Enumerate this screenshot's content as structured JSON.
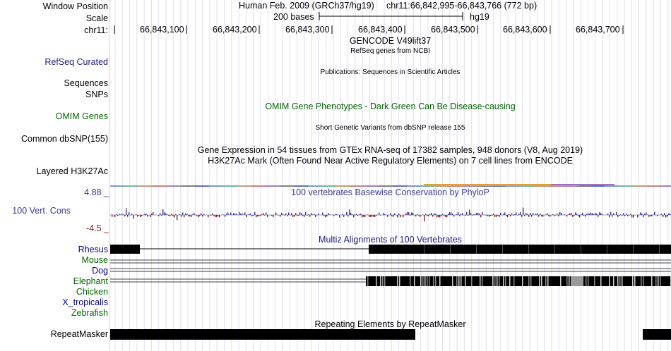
{
  "header": {
    "window_position_label": "Window Position",
    "scale_label": "Scale",
    "chrom_label": "chr11:",
    "assembly": "Human Feb. 2009 (GRCh37/hg19)",
    "position": "chr11:66,842,995-66,843,766 (772 bp)",
    "scale_text": "200 bases",
    "db": "hg19",
    "ruler_ticks": [
      "66,843,100",
      "66,843,200",
      "66,843,300",
      "66,843,400",
      "66,843,500",
      "66,843,600",
      "66,843,700"
    ]
  },
  "tracks": {
    "gencode_title": "GENCODE V49lift37",
    "refseq_sub": "RefSeq genes from NCBI",
    "refseq_label": "RefSeq Curated",
    "publications_title": "Publications: Sequences in Scientific Articles",
    "sequences_label": "Sequences",
    "snps_label": "SNPs",
    "omim_label": "OMIM Genes",
    "omim_title": "OMIM Gene Phenotypes - Dark Green Can Be Disease-causing",
    "dbsnp_title": "Short Genetic Variants from dbSNP release 155",
    "dbsnp_label": "Common dbSNP(155)",
    "gtex_title": "Gene Expression in 54 tissues from GTEx RNA-seq of 17382 samples, 948 donors (V8, Aug 2019)",
    "h3k27ac_title": "H3K27Ac Mark (Often Found Near Active Regulatory Elements) on 7 cell lines from ENCODE",
    "h3k27ac_label": "Layered H3K27Ac",
    "phylop_max": "4.88 _",
    "phylop_title": "100 vertebrates Basewise Conservation by PhyloP",
    "phylop_label": "100 Vert. Cons",
    "phylop_min": "-4.5 _",
    "multiz_title": "Multiz Alignments of 100 Vertebrates",
    "species": [
      "Rhesus",
      "Mouse",
      "Dog",
      "Elephant",
      "Chicken",
      "X_tropicalis",
      "Zebrafish"
    ],
    "repeat_title": "Repeating Elements by RepeatMasker",
    "repeat_label": "RepeatMasker"
  },
  "colors": {
    "refseq": "#20207f",
    "omim": "#006400",
    "phylop": "#3a3a90",
    "phylop_neg": "#8b1a1a",
    "species": "#000080",
    "species_green": "#006400",
    "guide_line": "#e0e0f0",
    "left_border": "#ffc0c0"
  }
}
